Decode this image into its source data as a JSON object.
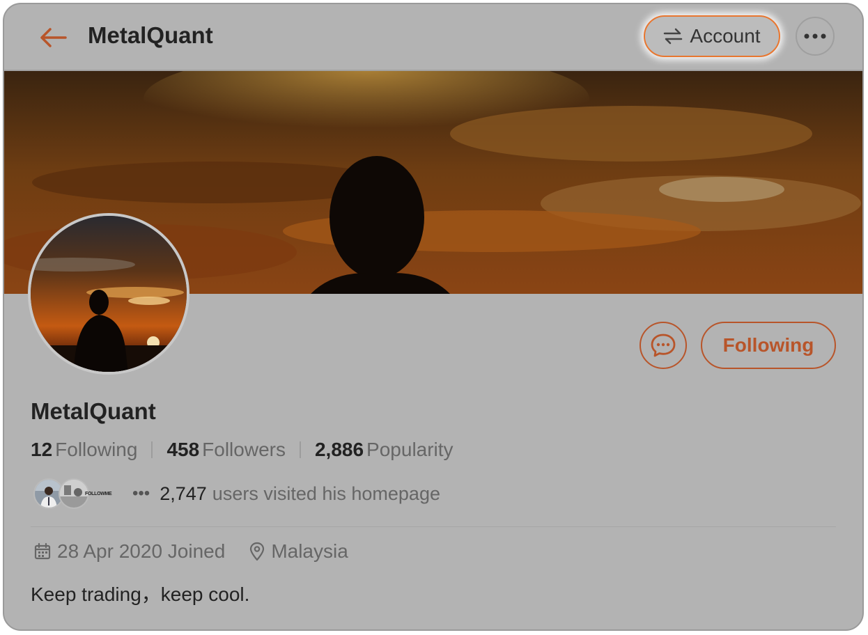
{
  "header": {
    "title": "MetalQuant",
    "account_label": "Account"
  },
  "profile": {
    "name": "MetalQuant",
    "following_button": "Following",
    "stats": [
      {
        "value": "12",
        "label": "Following"
      },
      {
        "value": "458",
        "label": "Followers"
      },
      {
        "value": "2,886",
        "label": "Popularity"
      }
    ],
    "visitors": {
      "avatar_badge_text": "FOLLOWME",
      "count": "2,747",
      "text": "users visited his homepage"
    },
    "joined": "28 Apr 2020 Joined",
    "location": "Malaysia",
    "bio": "Keep trading，keep cool."
  },
  "colors": {
    "accent": "#e8762f",
    "brand_dark": "#b8552a",
    "backdrop": "#b3b3b3"
  },
  "icons": [
    "back-arrow-icon",
    "swap-icon",
    "more-icon",
    "chat-icon",
    "calendar-icon",
    "location-pin-icon"
  ]
}
